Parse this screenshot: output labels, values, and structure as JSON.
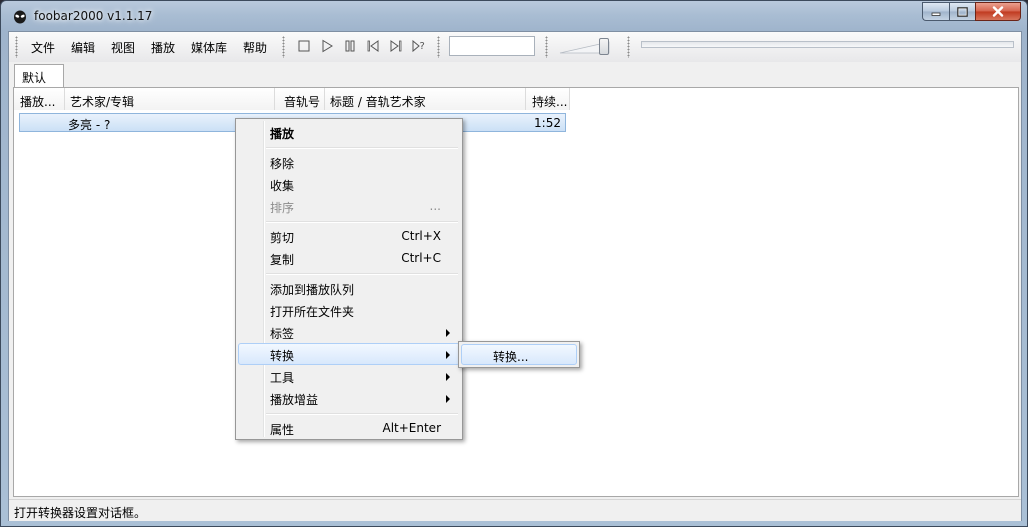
{
  "window": {
    "title": "foobar2000 v1.1.17"
  },
  "menubar": {
    "items": [
      "文件",
      "编辑",
      "视图",
      "播放",
      "媒体库",
      "帮助"
    ]
  },
  "toolbar": {
    "buttons": [
      "stop-icon",
      "play-icon",
      "pause-icon",
      "previous-icon",
      "next-icon",
      "random-icon"
    ],
    "search_value": ""
  },
  "tabs": [
    {
      "label": "默认",
      "active": true
    }
  ],
  "playlist": {
    "columns": [
      "播放...",
      "艺术家/专辑",
      "音轨号",
      "标题 / 音轨艺术家",
      "持续..."
    ],
    "rows": [
      {
        "artist_album": "多亮 - ?",
        "duration": "1:52"
      }
    ]
  },
  "context_menu": {
    "play": "播放",
    "remove": "移除",
    "favorite": "收集",
    "sort": "排序",
    "sort_ellipsis": "...",
    "cut": "剪切",
    "cut_shortcut": "Ctrl+X",
    "copy": "复制",
    "copy_shortcut": "Ctrl+C",
    "add_queue": "添加到播放队列",
    "open_folder": "打开所在文件夹",
    "tags": "标签",
    "convert": "转换",
    "tools": "工具",
    "replaygain": "播放增益",
    "properties": "属性",
    "properties_shortcut": "Alt+Enter"
  },
  "submenu": {
    "convert_item": "转换..."
  },
  "statusbar": {
    "text": "打开转换器设置对话框。"
  },
  "colors": {
    "accent": "#3399ff",
    "selection": "#cbe0f6",
    "menu_bg": "#f0f0f0"
  }
}
